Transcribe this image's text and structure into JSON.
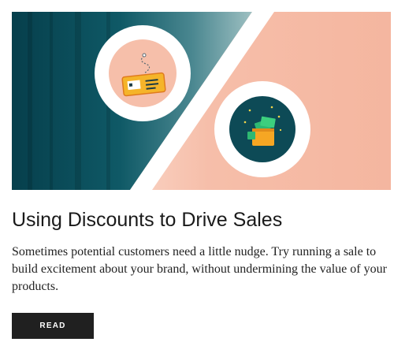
{
  "article": {
    "title": "Using Discounts to Drive Sales",
    "description": "Sometimes potential customers need a little nudge. Try running a sale to build excitement about your brand, without undermining the value of your products.",
    "read_label": "READ"
  },
  "hero": {
    "illustration": "percent-sign-discount-illustration",
    "icons": [
      "coupon-ticket-icon",
      "money-wallet-icon"
    ],
    "colors": {
      "teal": "#0d5160",
      "dark_teal": "#063b49",
      "peach": "#f6bba6",
      "coupon_yellow": "#f5b42a",
      "wallet_orange": "#f6a623",
      "money_green": "#2eb872",
      "white": "#ffffff"
    }
  }
}
